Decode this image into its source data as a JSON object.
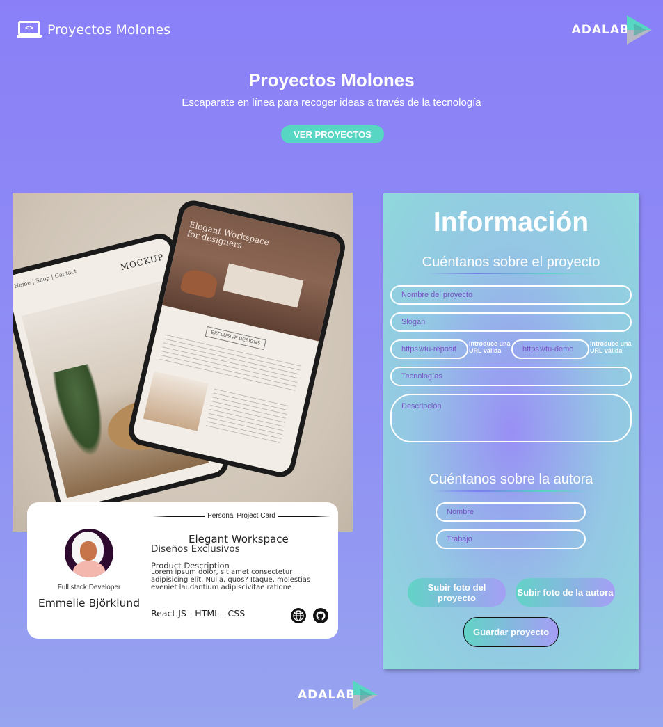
{
  "header": {
    "title": "Proyectos Molones",
    "laptop_glyph": "<>",
    "adalab_logo": "ADALAB"
  },
  "hero": {
    "title": "Proyectos Molones",
    "subtitle": "Escaparate en línea para recoger ideas a través de la tecnología",
    "button_label": "VER PROYECTOS"
  },
  "mockup": {
    "nav_home": "Home",
    "nav_shop": "Shop",
    "nav_contact": "Contact",
    "mockup_label": "MOCKUP",
    "workspace_title": "Elegant Workspace",
    "workspace_sub": "for designers",
    "badge": "EXCLUSIVE DESIGNS"
  },
  "card": {
    "header": "Personal Project Card",
    "role": "Full stack Developer",
    "author": "Emmelie Björklund",
    "project_name": "Elegant Workspace",
    "slogan": "Diseños Exclusivos",
    "desc_title": "Product Description",
    "desc": "Lorem ipsum dolor, sit amet consectetur adipisicing elit. Nulla, quos? Itaque, molestias eveniet laudantium adipiscivitae ratione",
    "technologies": "React JS - HTML - CSS"
  },
  "form": {
    "title": "Información",
    "project_section": "Cuéntanos sobre el proyecto",
    "author_section": "Cuéntanos sobre la autora",
    "placeholders": {
      "name": "Nombre del proyecto",
      "slogan": "Slogan",
      "repo": "https://tu-reposit",
      "demo": "https://tu-demo",
      "technologies": "Tecnologías",
      "description": "Descripción",
      "author": "Nombre",
      "job": "Trabajo"
    },
    "url_hint": "Introduce una URL válida",
    "upload_project": "Subir foto del proyecto",
    "upload_author": "Subir foto de la autora",
    "save": "Guardar proyecto"
  },
  "colors": {
    "accent": "#56d6c3",
    "background": "#8a7ff7",
    "placeholder": "#7a52c8"
  },
  "icons": [
    "laptop-code-icon",
    "globe-icon",
    "github-icon",
    "adalab-arrow-icon"
  ]
}
